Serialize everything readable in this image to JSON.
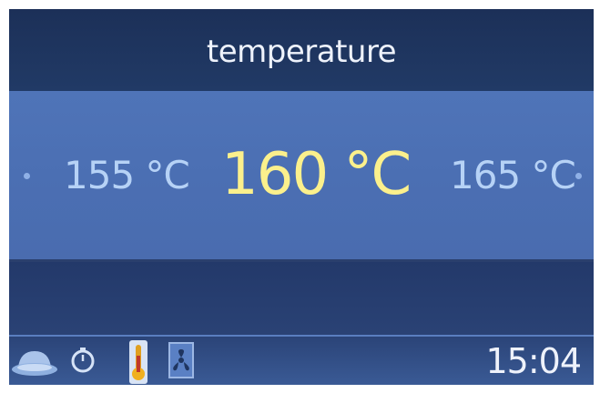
{
  "header": {
    "title": "temperature"
  },
  "selector": {
    "previous": "155 °C",
    "current": "160 °C",
    "next": "165 °C",
    "left_indicator": "dot-icon",
    "right_indicator": "dot-icon"
  },
  "status_bar": {
    "icons": [
      "dish-icon",
      "timer-icon",
      "thermometer-icon",
      "fan-icon"
    ],
    "active_icon": "thermometer-icon",
    "time": "15:04"
  },
  "colors": {
    "background": "#1f3560",
    "band": "#4f74b8",
    "selected_value": "#fbf08c",
    "side_value": "#b6d2f6",
    "title_text": "#eef2fb"
  }
}
